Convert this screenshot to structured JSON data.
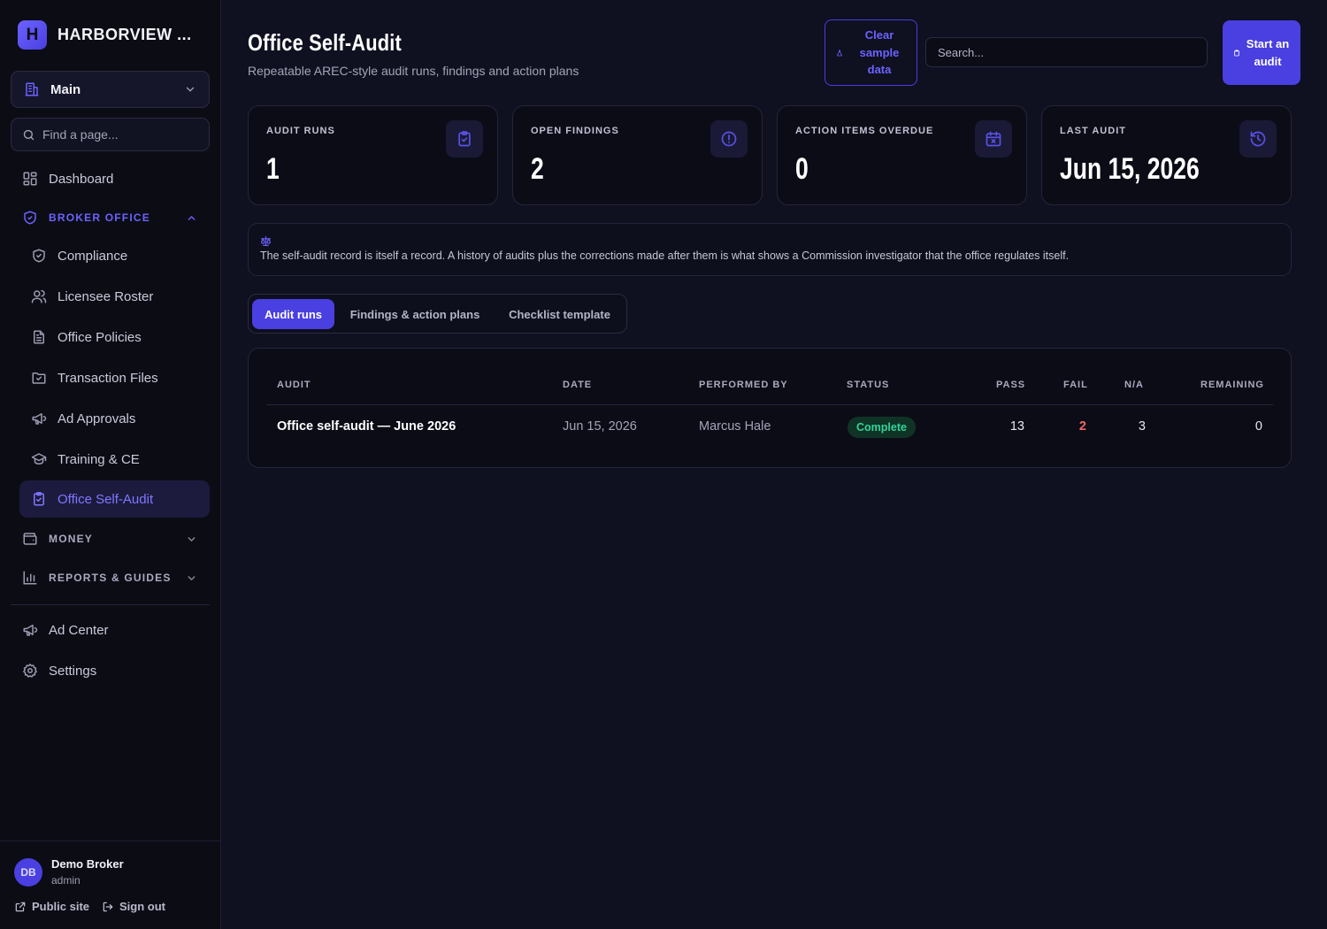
{
  "brand": {
    "initial": "H",
    "name": "HARBORVIEW ..."
  },
  "sidebar": {
    "workspace": "Main",
    "find_placeholder": "Find a page...",
    "dashboard": "Dashboard",
    "broker_office": "BROKER OFFICE",
    "items": [
      {
        "label": "Compliance",
        "icon": "shield-check-icon"
      },
      {
        "label": "Licensee Roster",
        "icon": "users-icon"
      },
      {
        "label": "Office Policies",
        "icon": "file-text-icon"
      },
      {
        "label": "Transaction Files",
        "icon": "folder-check-icon"
      },
      {
        "label": "Ad Approvals",
        "icon": "megaphone-icon"
      },
      {
        "label": "Training & CE",
        "icon": "graduation-cap-icon"
      },
      {
        "label": "Office Self-Audit",
        "icon": "clipboard-check-icon",
        "active": true
      }
    ],
    "money": "MONEY",
    "reports": "REPORTS & GUIDES",
    "ad_center": "Ad Center",
    "settings": "Settings"
  },
  "user": {
    "initials": "DB",
    "name": "Demo Broker",
    "role": "admin",
    "public_site": "Public site",
    "sign_out": "Sign out"
  },
  "header": {
    "title": "Office Self-Audit",
    "subtitle": "Repeatable AREC-style audit runs, findings and action plans",
    "clear_button": "Clear sample data",
    "search_placeholder": "Search...",
    "start_button": "Start an audit"
  },
  "stats": [
    {
      "label": "AUDIT RUNS",
      "value": "1",
      "icon": "clipboard-check-icon"
    },
    {
      "label": "OPEN FINDINGS",
      "value": "2",
      "icon": "alert-circle-icon"
    },
    {
      "label": "ACTION ITEMS OVERDUE",
      "value": "0",
      "icon": "calendar-x-icon"
    },
    {
      "label": "LAST AUDIT",
      "value": "Jun 15, 2026",
      "icon": "history-icon"
    }
  ],
  "note": {
    "icon": "scale-icon",
    "text": "The self-audit record is itself a record. A history of audits plus the corrections made after them is what shows a Commission investigator that the office regulates itself."
  },
  "tabs": [
    "Audit runs",
    "Findings & action plans",
    "Checklist template"
  ],
  "active_tab": "Audit runs",
  "table": {
    "headers": {
      "audit": "AUDIT",
      "date": "DATE",
      "performed_by": "PERFORMED BY",
      "status": "STATUS",
      "pass": "PASS",
      "fail": "FAIL",
      "na": "N/A",
      "remaining": "REMAINING"
    },
    "rows": [
      {
        "audit": "Office self-audit — June 2026",
        "date": "Jun 15, 2026",
        "performed_by": "Marcus Hale",
        "status": "Complete",
        "pass": "13",
        "fail": "2",
        "na": "3",
        "remaining": "0"
      }
    ]
  },
  "colors": {
    "accent": "#4a3fe0",
    "accent_text": "#6b63ff",
    "background": "#0f1020",
    "sidebar": "#0c0c15",
    "status_complete": "#34d399",
    "fail": "#f06767"
  }
}
